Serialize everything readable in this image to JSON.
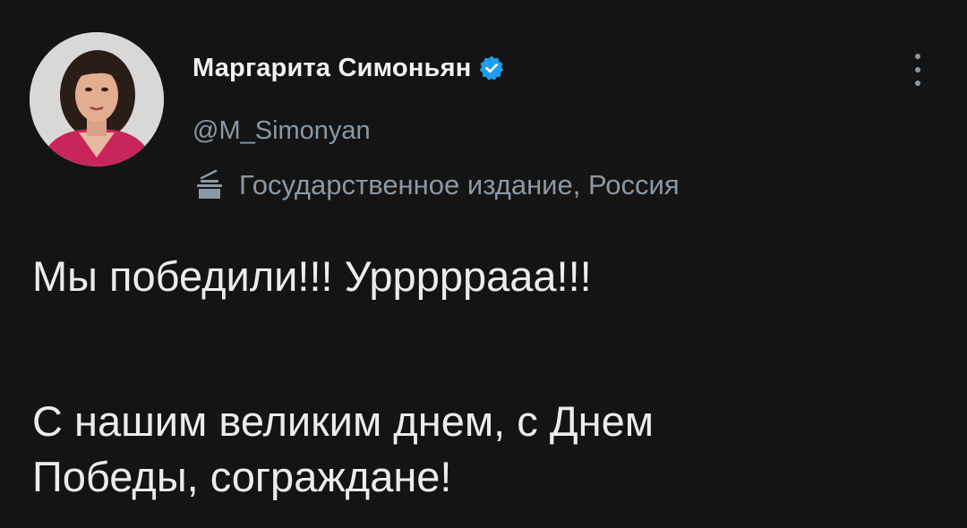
{
  "author": {
    "display_name": "Маргарита Симоньян",
    "handle": "@M_Simonyan",
    "verified": true,
    "label": "Государственное издание, Россия"
  },
  "tweet": {
    "line1": "Мы победили!!! Урррррааа!!!",
    "line2": "С нашим великим днем, с Днем",
    "line3": "Победы, сограждане!"
  },
  "icons": {
    "verified": "verified-badge-icon",
    "label": "podium-icon",
    "more": "more-vertical-icon"
  },
  "colors": {
    "background": "#141414",
    "text": "#e7e9ea",
    "muted": "#8b98a5",
    "accent": "#1d9bf0"
  }
}
